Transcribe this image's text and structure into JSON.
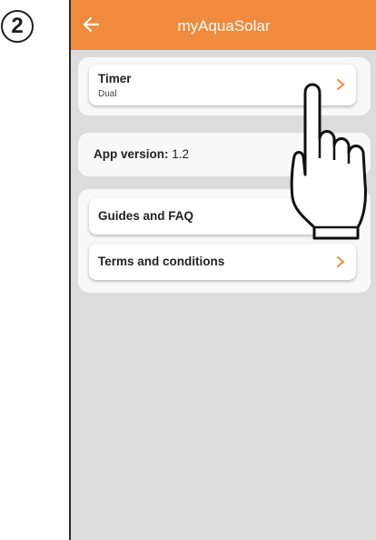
{
  "step": {
    "number": "2"
  },
  "appbar": {
    "title": "myAquaSolar",
    "back_icon": "arrow-left-icon"
  },
  "timer": {
    "label": "Timer",
    "value": "Dual"
  },
  "app_version": {
    "label": "App version:",
    "value": "1.2"
  },
  "links": [
    {
      "label": "Guides and FAQ"
    },
    {
      "label": "Terms and conditions"
    }
  ],
  "colors": {
    "accent": "#f08a3c",
    "background": "#dcdcdc",
    "card": "#f8f8f8"
  },
  "pointer": {
    "icon": "pointing-hand-icon"
  }
}
